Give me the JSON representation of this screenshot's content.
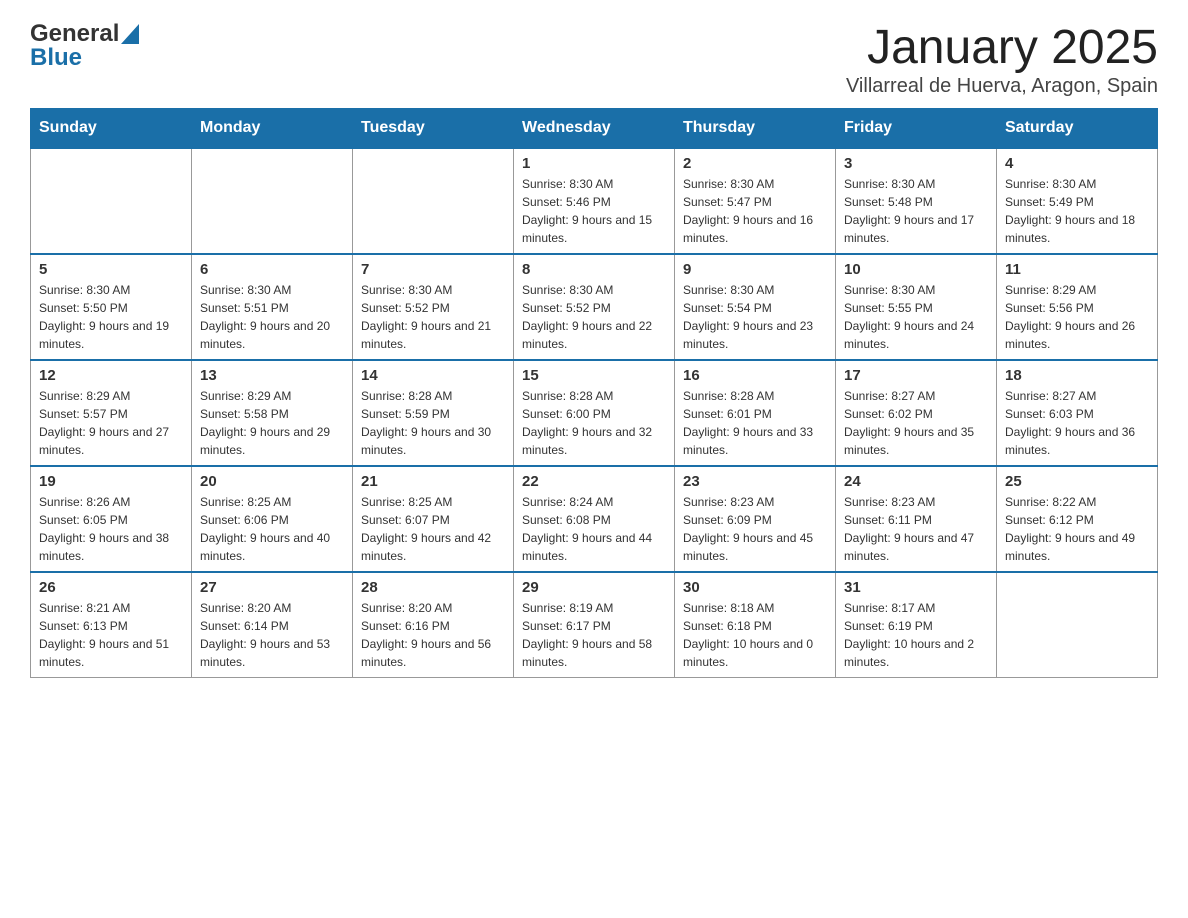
{
  "logo": {
    "general": "General",
    "blue": "Blue"
  },
  "title": "January 2025",
  "subtitle": "Villarreal de Huerva, Aragon, Spain",
  "days_of_week": [
    "Sunday",
    "Monday",
    "Tuesday",
    "Wednesday",
    "Thursday",
    "Friday",
    "Saturday"
  ],
  "weeks": [
    [
      {
        "day": "",
        "info": ""
      },
      {
        "day": "",
        "info": ""
      },
      {
        "day": "",
        "info": ""
      },
      {
        "day": "1",
        "info": "Sunrise: 8:30 AM\nSunset: 5:46 PM\nDaylight: 9 hours and 15 minutes."
      },
      {
        "day": "2",
        "info": "Sunrise: 8:30 AM\nSunset: 5:47 PM\nDaylight: 9 hours and 16 minutes."
      },
      {
        "day": "3",
        "info": "Sunrise: 8:30 AM\nSunset: 5:48 PM\nDaylight: 9 hours and 17 minutes."
      },
      {
        "day": "4",
        "info": "Sunrise: 8:30 AM\nSunset: 5:49 PM\nDaylight: 9 hours and 18 minutes."
      }
    ],
    [
      {
        "day": "5",
        "info": "Sunrise: 8:30 AM\nSunset: 5:50 PM\nDaylight: 9 hours and 19 minutes."
      },
      {
        "day": "6",
        "info": "Sunrise: 8:30 AM\nSunset: 5:51 PM\nDaylight: 9 hours and 20 minutes."
      },
      {
        "day": "7",
        "info": "Sunrise: 8:30 AM\nSunset: 5:52 PM\nDaylight: 9 hours and 21 minutes."
      },
      {
        "day": "8",
        "info": "Sunrise: 8:30 AM\nSunset: 5:52 PM\nDaylight: 9 hours and 22 minutes."
      },
      {
        "day": "9",
        "info": "Sunrise: 8:30 AM\nSunset: 5:54 PM\nDaylight: 9 hours and 23 minutes."
      },
      {
        "day": "10",
        "info": "Sunrise: 8:30 AM\nSunset: 5:55 PM\nDaylight: 9 hours and 24 minutes."
      },
      {
        "day": "11",
        "info": "Sunrise: 8:29 AM\nSunset: 5:56 PM\nDaylight: 9 hours and 26 minutes."
      }
    ],
    [
      {
        "day": "12",
        "info": "Sunrise: 8:29 AM\nSunset: 5:57 PM\nDaylight: 9 hours and 27 minutes."
      },
      {
        "day": "13",
        "info": "Sunrise: 8:29 AM\nSunset: 5:58 PM\nDaylight: 9 hours and 29 minutes."
      },
      {
        "day": "14",
        "info": "Sunrise: 8:28 AM\nSunset: 5:59 PM\nDaylight: 9 hours and 30 minutes."
      },
      {
        "day": "15",
        "info": "Sunrise: 8:28 AM\nSunset: 6:00 PM\nDaylight: 9 hours and 32 minutes."
      },
      {
        "day": "16",
        "info": "Sunrise: 8:28 AM\nSunset: 6:01 PM\nDaylight: 9 hours and 33 minutes."
      },
      {
        "day": "17",
        "info": "Sunrise: 8:27 AM\nSunset: 6:02 PM\nDaylight: 9 hours and 35 minutes."
      },
      {
        "day": "18",
        "info": "Sunrise: 8:27 AM\nSunset: 6:03 PM\nDaylight: 9 hours and 36 minutes."
      }
    ],
    [
      {
        "day": "19",
        "info": "Sunrise: 8:26 AM\nSunset: 6:05 PM\nDaylight: 9 hours and 38 minutes."
      },
      {
        "day": "20",
        "info": "Sunrise: 8:25 AM\nSunset: 6:06 PM\nDaylight: 9 hours and 40 minutes."
      },
      {
        "day": "21",
        "info": "Sunrise: 8:25 AM\nSunset: 6:07 PM\nDaylight: 9 hours and 42 minutes."
      },
      {
        "day": "22",
        "info": "Sunrise: 8:24 AM\nSunset: 6:08 PM\nDaylight: 9 hours and 44 minutes."
      },
      {
        "day": "23",
        "info": "Sunrise: 8:23 AM\nSunset: 6:09 PM\nDaylight: 9 hours and 45 minutes."
      },
      {
        "day": "24",
        "info": "Sunrise: 8:23 AM\nSunset: 6:11 PM\nDaylight: 9 hours and 47 minutes."
      },
      {
        "day": "25",
        "info": "Sunrise: 8:22 AM\nSunset: 6:12 PM\nDaylight: 9 hours and 49 minutes."
      }
    ],
    [
      {
        "day": "26",
        "info": "Sunrise: 8:21 AM\nSunset: 6:13 PM\nDaylight: 9 hours and 51 minutes."
      },
      {
        "day": "27",
        "info": "Sunrise: 8:20 AM\nSunset: 6:14 PM\nDaylight: 9 hours and 53 minutes."
      },
      {
        "day": "28",
        "info": "Sunrise: 8:20 AM\nSunset: 6:16 PM\nDaylight: 9 hours and 56 minutes."
      },
      {
        "day": "29",
        "info": "Sunrise: 8:19 AM\nSunset: 6:17 PM\nDaylight: 9 hours and 58 minutes."
      },
      {
        "day": "30",
        "info": "Sunrise: 8:18 AM\nSunset: 6:18 PM\nDaylight: 10 hours and 0 minutes."
      },
      {
        "day": "31",
        "info": "Sunrise: 8:17 AM\nSunset: 6:19 PM\nDaylight: 10 hours and 2 minutes."
      },
      {
        "day": "",
        "info": ""
      }
    ]
  ]
}
